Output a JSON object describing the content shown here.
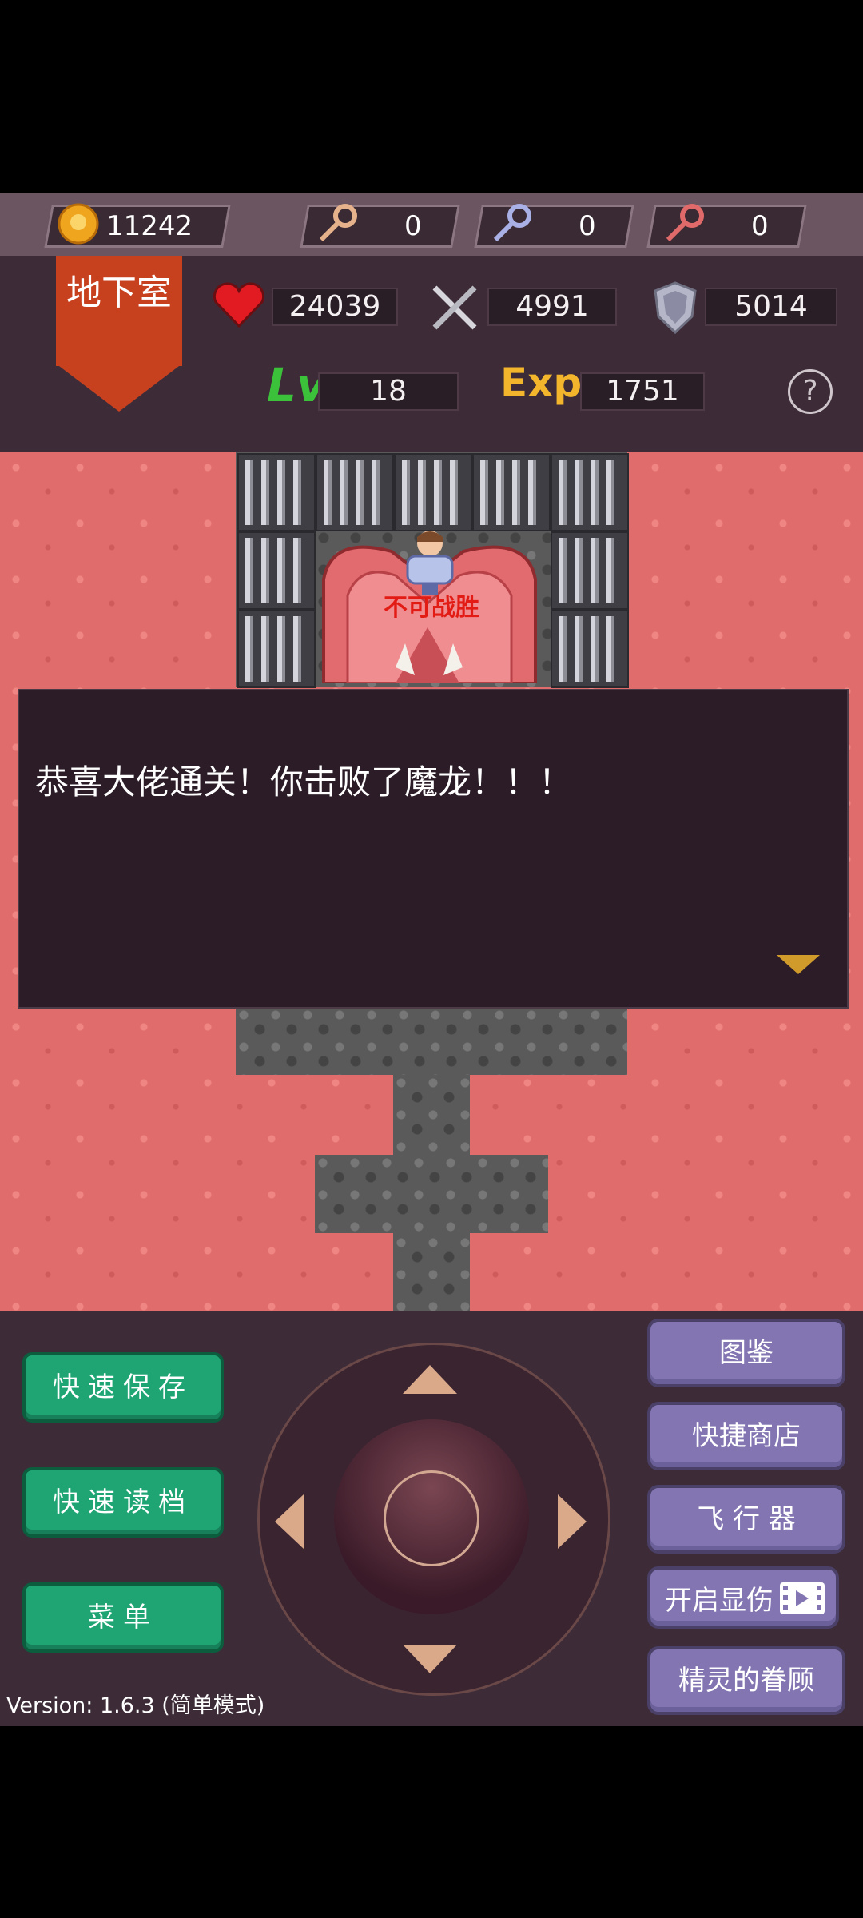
{
  "resources": {
    "gold": "11242",
    "yellow_key": "0",
    "blue_key": "0",
    "red_key": "0"
  },
  "status": {
    "floor": "地下室",
    "hp": "24039",
    "attack": "4991",
    "defense": "5014",
    "level_label": "Lv",
    "level": "18",
    "exp_label": "Exp",
    "exp": "1751",
    "help_icon": "?"
  },
  "map": {
    "enemy_tag": "不可战胜"
  },
  "dialog": {
    "text": "恭喜大佬通关！你击败了魔龙！！！"
  },
  "buttons": {
    "quick_save": "快速保存",
    "quick_load": "快速读档",
    "menu": "菜单",
    "encyclopedia": "图鉴",
    "quick_shop": "快捷商店",
    "flyer": "飞 行 器",
    "show_damage": "开启显伤",
    "spirit_favor": "精灵的眷顾"
  },
  "version": "Version: 1.6.3 (简单模式)"
}
